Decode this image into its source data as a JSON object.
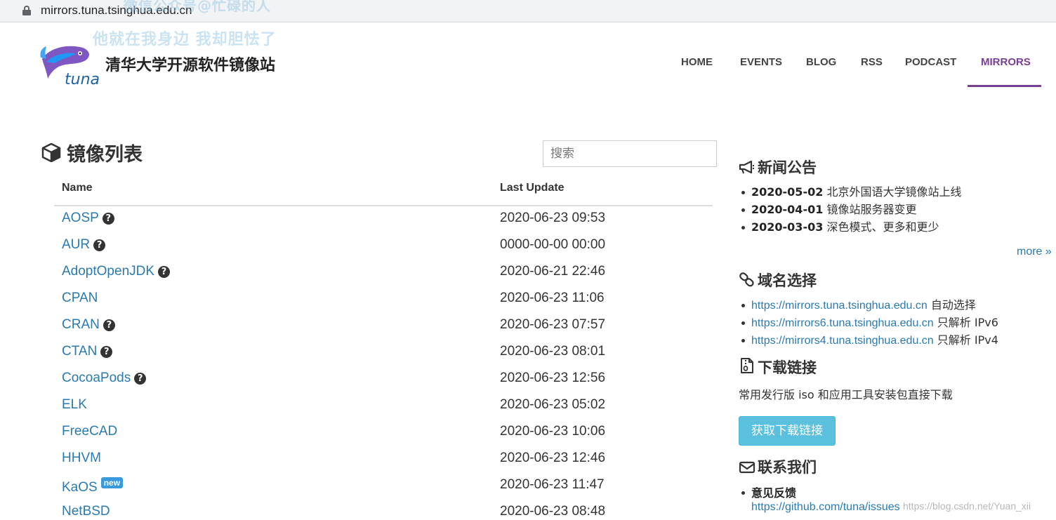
{
  "browser": {
    "url": "mirrors.tuna.tsinghua.edu.cn"
  },
  "watermark": {
    "line1": "微信公众号@忙碌的人",
    "line2": "他就在我身边 我却胆怯了",
    "csdn": "https://blog.csdn.net/Yuan_xii"
  },
  "header": {
    "logo_text": "tuna",
    "site_title": "清华大学开源软件镜像站",
    "nav": [
      "HOME",
      "EVENTS",
      "BLOG",
      "RSS",
      "PODCAST",
      "MIRRORS"
    ],
    "active_nav": "MIRRORS",
    "accent_color": "#7a3f93"
  },
  "mirrors": {
    "title": "镜像列表",
    "search_placeholder": "搜索",
    "col_name": "Name",
    "col_update": "Last Update",
    "rows": [
      {
        "name": "AOSP",
        "help": true,
        "new": false,
        "time": "2020-06-23 09:53"
      },
      {
        "name": "AUR",
        "help": true,
        "new": false,
        "time": "0000-00-00 00:00"
      },
      {
        "name": "AdoptOpenJDK",
        "help": true,
        "new": false,
        "time": "2020-06-21 22:46"
      },
      {
        "name": "CPAN",
        "help": false,
        "new": false,
        "time": "2020-06-23 11:06"
      },
      {
        "name": "CRAN",
        "help": true,
        "new": false,
        "time": "2020-06-23 07:57"
      },
      {
        "name": "CTAN",
        "help": true,
        "new": false,
        "time": "2020-06-23 08:01"
      },
      {
        "name": "CocoaPods",
        "help": true,
        "new": false,
        "time": "2020-06-23 12:56"
      },
      {
        "name": "ELK",
        "help": false,
        "new": false,
        "time": "2020-06-23 05:02"
      },
      {
        "name": "FreeCAD",
        "help": false,
        "new": false,
        "time": "2020-06-23 10:06"
      },
      {
        "name": "HHVM",
        "help": false,
        "new": false,
        "time": "2020-06-23 12:46"
      },
      {
        "name": "KaOS",
        "help": false,
        "new": true,
        "time": "2020-06-23 11:47"
      },
      {
        "name": "NetBSD",
        "help": false,
        "new": false,
        "time": "2020-06-23 08:48"
      }
    ],
    "help_glyph": "?",
    "new_label": "new",
    "link_color": "#2a7ab0"
  },
  "sidebar": {
    "news_title": "新闻公告",
    "news": [
      {
        "date": "2020-05-02",
        "text": "北京外国语大学镜像站上线"
      },
      {
        "date": "2020-04-01",
        "text": "镜像站服务器变更"
      },
      {
        "date": "2020-03-03",
        "text": "深色模式、更多和更少"
      }
    ],
    "more_label": "more »",
    "domain_title": "域名选择",
    "domains": [
      {
        "url": "https://mirrors.tuna.tsinghua.edu.cn",
        "note": "自动选择"
      },
      {
        "url": "https://mirrors6.tuna.tsinghua.edu.cn",
        "note": "只解析 IPv6"
      },
      {
        "url": "https://mirrors4.tuna.tsinghua.edu.cn",
        "note": "只解析 IPv4"
      }
    ],
    "download_title": "下载链接",
    "download_desc": "常用发行版 iso 和应用工具安装包直接下载",
    "download_button": "获取下载链接",
    "button_color": "#5bc0de",
    "contact_title": "联系我们",
    "feedback_title": "意见反馈",
    "feedback_url": "https://github.com/tuna/issues"
  }
}
